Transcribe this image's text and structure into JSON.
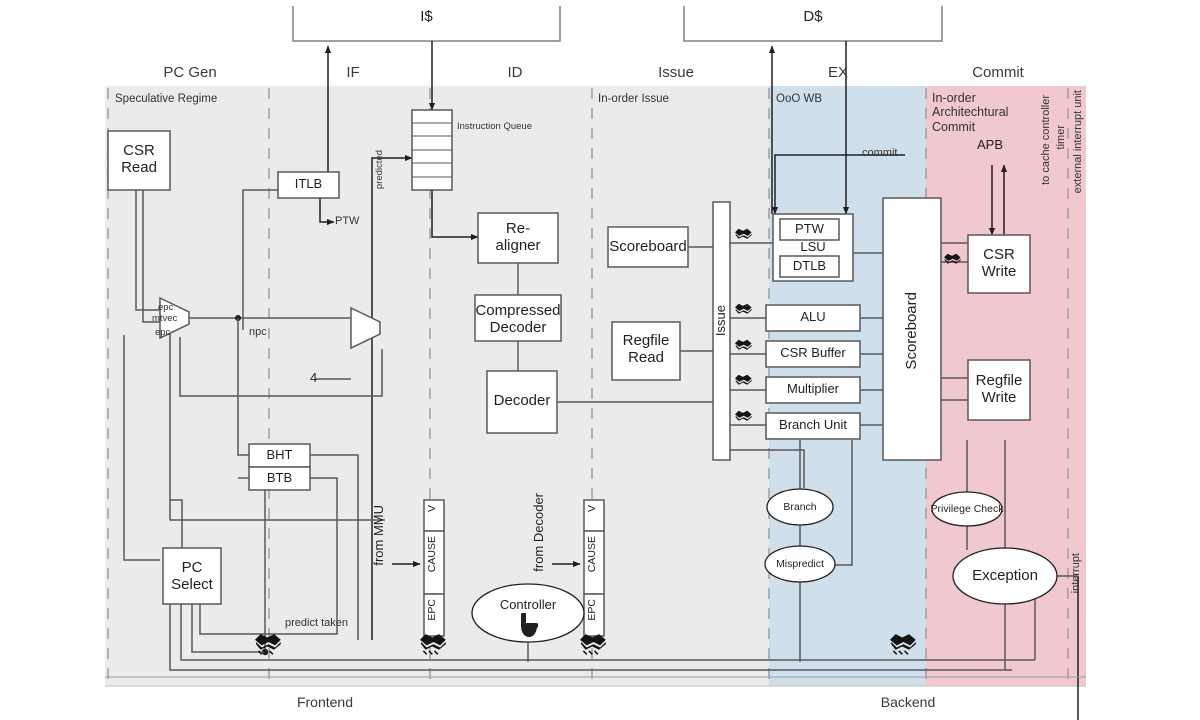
{
  "diagram": {
    "title": "RISC-V CPU Pipeline Block Diagram",
    "colors": {
      "frontend_gray": "#ebebeb",
      "ooo_blue": "#cfe0ec",
      "commit_pink": "#f0c8cd",
      "stroke": "#58595b",
      "text": "#231f20"
    }
  },
  "caches": [
    {
      "label": "I$"
    },
    {
      "label": "D$"
    }
  ],
  "stages": [
    {
      "label": "PC Gen"
    },
    {
      "label": "IF"
    },
    {
      "label": "ID"
    },
    {
      "label": "Issue"
    },
    {
      "label": "EX"
    },
    {
      "label": "Commit"
    }
  ],
  "regions": [
    {
      "label": "Speculative Regime"
    },
    {
      "label": "In-order Issue"
    },
    {
      "label": "OoO WB"
    },
    {
      "label": "In-order\nArchitechtural\nCommit"
    }
  ],
  "footers": [
    {
      "label": "Frontend"
    },
    {
      "label": "Backend"
    }
  ],
  "blocks": {
    "csr_read": "CSR\nRead",
    "itlb": "ITLB",
    "instruction_queue": "Instruction Queue",
    "realigner": "Re-\naligner",
    "compressed_decoder": "Compressed\nDecoder",
    "decoder": "Decoder",
    "scoreboard_issue": "Scoreboard",
    "regfile_read": "Regfile\nRead",
    "issue": "Issue",
    "ptw_unit": "PTW",
    "lsu": "LSU",
    "dtlb": "DTLB",
    "alu": "ALU",
    "csr_buffer": "CSR Buffer",
    "multiplier": "Multiplier",
    "branch_unit": "Branch Unit",
    "scoreboard_ex": "Scoreboard",
    "csr_write": "CSR\nWrite",
    "regfile_write": "Regfile\nWrite",
    "bht": "BHT",
    "btb": "BTB",
    "pc_select": "PC\nSelect",
    "controller": "Controller",
    "branch_oval": "Branch",
    "mispredict_oval": "Mispredict",
    "privilege_check": "Privilege Check",
    "exception": "Exception"
  },
  "exception_regs": [
    {
      "fields": [
        "V",
        "CAUSE",
        "EPC"
      ],
      "source": "from MMU"
    },
    {
      "fields": [
        "V",
        "CAUSE",
        "EPC"
      ],
      "source": "from Decoder"
    }
  ],
  "wire_labels": {
    "ptw_out": "PTW",
    "predicted": "predicted",
    "epc_top": "epc",
    "mtvec": "mtvec",
    "epc_bottom": "epc",
    "npc": "npc",
    "plus_four": "4",
    "predict_taken": "predict taken",
    "commit": "commit",
    "apb": "APB",
    "interrupt": "interrupt",
    "to_cache_controller": "to cache controller",
    "timer": "timer",
    "external_interrupt_unit": "external interrupt unit",
    "from_mmu": "from MMU",
    "from_decoder": "from Decoder"
  },
  "icons": {
    "handshake": "handshake-icon",
    "controller_glyph": "flush-glyph-icon"
  }
}
